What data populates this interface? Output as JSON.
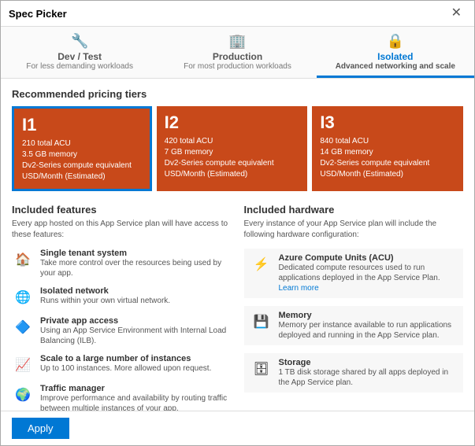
{
  "window": {
    "title": "Spec Picker",
    "close_label": "✕"
  },
  "tabs": [
    {
      "id": "dev-test",
      "icon": "🔧",
      "title": "Dev / Test",
      "subtitle": "For less demanding workloads",
      "active": false
    },
    {
      "id": "production",
      "icon": "🏢",
      "title": "Production",
      "subtitle": "For most production workloads",
      "active": false
    },
    {
      "id": "isolated",
      "icon": "🔒",
      "title": "Isolated",
      "subtitle": "Advanced networking and scale",
      "active": true
    }
  ],
  "pricing_section": {
    "title": "Recommended pricing tiers",
    "tiers": [
      {
        "id": "I1",
        "acu": "210 total ACU",
        "memory": "3.5 GB memory",
        "compute": "Dv2-Series compute equivalent",
        "price": "USD/Month (Estimated)",
        "selected": true
      },
      {
        "id": "I2",
        "acu": "420 total ACU",
        "memory": "7 GB memory",
        "compute": "Dv2-Series compute equivalent",
        "price": "USD/Month (Estimated)",
        "selected": false
      },
      {
        "id": "I3",
        "acu": "840 total ACU",
        "memory": "14 GB memory",
        "compute": "Dv2-Series compute equivalent",
        "price": "USD/Month (Estimated)",
        "selected": false
      }
    ]
  },
  "features_section": {
    "title": "Included features",
    "subtitle": "Every app hosted on this App Service plan will have access to these features:",
    "items": [
      {
        "name": "Single tenant system",
        "desc": "Take more control over the resources being used by your app.",
        "icon": "🏠"
      },
      {
        "name": "Isolated network",
        "desc": "Runs within your own virtual network.",
        "icon": "🌐"
      },
      {
        "name": "Private app access",
        "desc": "Using an App Service Environment with Internal Load Balancing (ILB).",
        "icon": "🔷"
      },
      {
        "name": "Scale to a large number of instances",
        "desc": "Up to 100 instances. More allowed upon request.",
        "icon": "📈"
      },
      {
        "name": "Traffic manager",
        "desc": "Improve performance and availability by routing traffic between multiple instances of your app.",
        "icon": "🌍"
      }
    ]
  },
  "hardware_section": {
    "title": "Included hardware",
    "subtitle": "Every instance of your App Service plan will include the following hardware configuration:",
    "items": [
      {
        "name": "Azure Compute Units (ACU)",
        "desc": "Dedicated compute resources used to run applications deployed in the App Service Plan.",
        "learn_more_text": "Learn more",
        "icon": "⚡"
      },
      {
        "name": "Memory",
        "desc": "Memory per instance available to run applications deployed and running in the App Service plan.",
        "icon": "💾"
      },
      {
        "name": "Storage",
        "desc": "1 TB disk storage shared by all apps deployed in the App Service plan.",
        "icon": "🗄"
      }
    ]
  },
  "footer": {
    "apply_label": "Apply"
  }
}
